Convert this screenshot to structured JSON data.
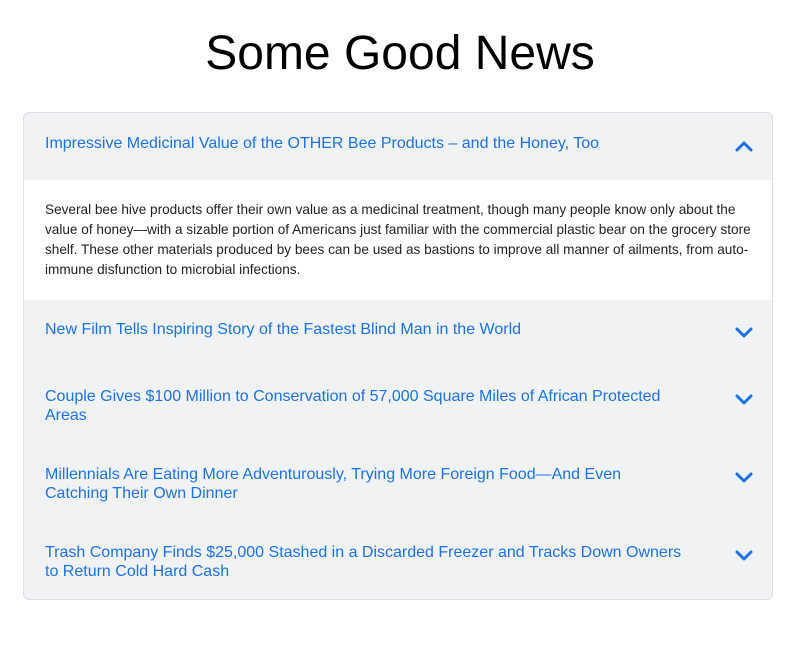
{
  "page": {
    "title": "Some Good News"
  },
  "colors": {
    "accent": "#1a73e8",
    "panel_background": "#f1f2f4",
    "body_background": "#ffffff"
  },
  "accordion": {
    "items": [
      {
        "title": "Impressive Medicinal Value of the OTHER Bee Products – and the Honey, Too",
        "expanded": true,
        "icon": "chevron-up-icon",
        "body": "Several bee hive products offer their own value as a medicinal treatment, though many people know only about the value of honey—with a sizable portion of Americans just familiar with the commercial plastic bear on the grocery store shelf. These other materials produced by bees can be used as bastions to improve all manner of ailments, from auto-immune disfunction to microbial infections."
      },
      {
        "title": "New Film Tells Inspiring Story of the Fastest Blind Man in the World",
        "expanded": false,
        "icon": "chevron-down-icon"
      },
      {
        "title": "Couple Gives $100 Million to Conservation of 57,000 Square Miles of African Protected Areas",
        "expanded": false,
        "icon": "chevron-down-icon"
      },
      {
        "title": "Millennials Are Eating More Adventurously, Trying More Foreign Food—And Even Catching Their Own Dinner",
        "expanded": false,
        "icon": "chevron-down-icon"
      },
      {
        "title": "Trash Company Finds $25,000 Stashed in a Discarded Freezer and Tracks Down Owners to Return Cold Hard Cash",
        "expanded": false,
        "icon": "chevron-down-icon"
      }
    ]
  }
}
